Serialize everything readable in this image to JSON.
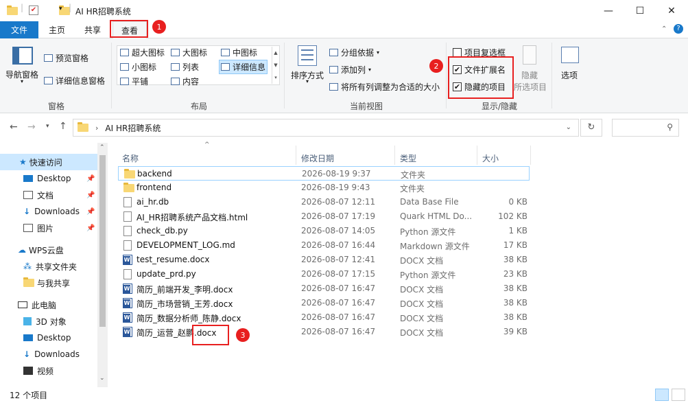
{
  "window": {
    "title": "AI HR招聘系统",
    "minimize": "—",
    "maximize": "☐",
    "close": "✕"
  },
  "tabs": {
    "file": "文件",
    "home": "主页",
    "share": "共享",
    "view": "查看"
  },
  "ribbon": {
    "pane": {
      "nav_pane": "导航窗格",
      "preview": "预览窗格",
      "details": "详细信息窗格",
      "group": "窗格"
    },
    "layout": {
      "xl": "超大图标",
      "large": "大图标",
      "medium": "中图标",
      "small": "小图标",
      "list": "列表",
      "details": "详细信息",
      "tiles": "平铺",
      "content": "内容",
      "group": "布局"
    },
    "current": {
      "sort": "排序方式",
      "groupby": "分组依据",
      "addcol": "添加列",
      "fit": "将所有列调整为合适的大小",
      "group": "当前视图"
    },
    "show": {
      "item_checkbox": "项目复选框",
      "file_ext": "文件扩展名",
      "hidden": "隐藏的项目",
      "hide": "隐藏",
      "hide_sel": "所选项目",
      "group": "显示/隐藏",
      "file_ext_checked": "✔",
      "hidden_checked": "✔"
    },
    "options": "选项"
  },
  "address": {
    "path": "AI HR招聘系统"
  },
  "nav": {
    "quick": "快速访问",
    "desktop": "Desktop",
    "docs": "文档",
    "downloads": "Downloads",
    "pics": "图片",
    "wps": "WPS云盘",
    "shared_folder": "共享文件夹",
    "shared_with_me": "与我共享",
    "pc": "此电脑",
    "obj3d": "3D 对象",
    "desktop2": "Desktop",
    "downloads2": "Downloads",
    "video": "视频"
  },
  "columns": {
    "name": "名称",
    "date": "修改日期",
    "type": "类型",
    "size": "大小"
  },
  "files": [
    {
      "name": "backend",
      "date": "2026-08-19 9:37",
      "type": "文件夹",
      "size": ""
    },
    {
      "name": "frontend",
      "date": "2026-08-19 9:43",
      "type": "文件夹",
      "size": ""
    },
    {
      "name": "ai_hr.db",
      "date": "2026-08-07 12:11",
      "type": "Data Base File",
      "size": "0 KB"
    },
    {
      "name": "AI_HR招聘系统产品文档.html",
      "date": "2026-08-07 17:19",
      "type": "Quark HTML Do...",
      "size": "102 KB"
    },
    {
      "name": "check_db.py",
      "date": "2026-08-07 14:05",
      "type": "Python 源文件",
      "size": "1 KB"
    },
    {
      "name": "DEVELOPMENT_LOG.md",
      "date": "2026-08-07 16:44",
      "type": "Markdown 源文件",
      "size": "17 KB"
    },
    {
      "name": "test_resume.docx",
      "date": "2026-08-07 12:41",
      "type": "DOCX 文档",
      "size": "38 KB"
    },
    {
      "name": "update_prd.py",
      "date": "2026-08-07 17:15",
      "type": "Python 源文件",
      "size": "23 KB"
    },
    {
      "name": "简历_前端开发_李明.docx",
      "date": "2026-08-07 16:47",
      "type": "DOCX 文档",
      "size": "38 KB"
    },
    {
      "name": "简历_市场营销_王芳.docx",
      "date": "2026-08-07 16:47",
      "type": "DOCX 文档",
      "size": "38 KB"
    },
    {
      "name": "简历_数据分析师_陈静.docx",
      "date": "2026-08-07 16:47",
      "type": "DOCX 文档",
      "size": "38 KB"
    },
    {
      "name": "简历_运营_赵鹏.docx",
      "date": "2026-08-07 16:47",
      "type": "DOCX 文档",
      "size": "39 KB"
    }
  ],
  "status": {
    "count": "12 个项目"
  },
  "badges": {
    "b1": "1",
    "b2": "2",
    "b3": "3"
  }
}
